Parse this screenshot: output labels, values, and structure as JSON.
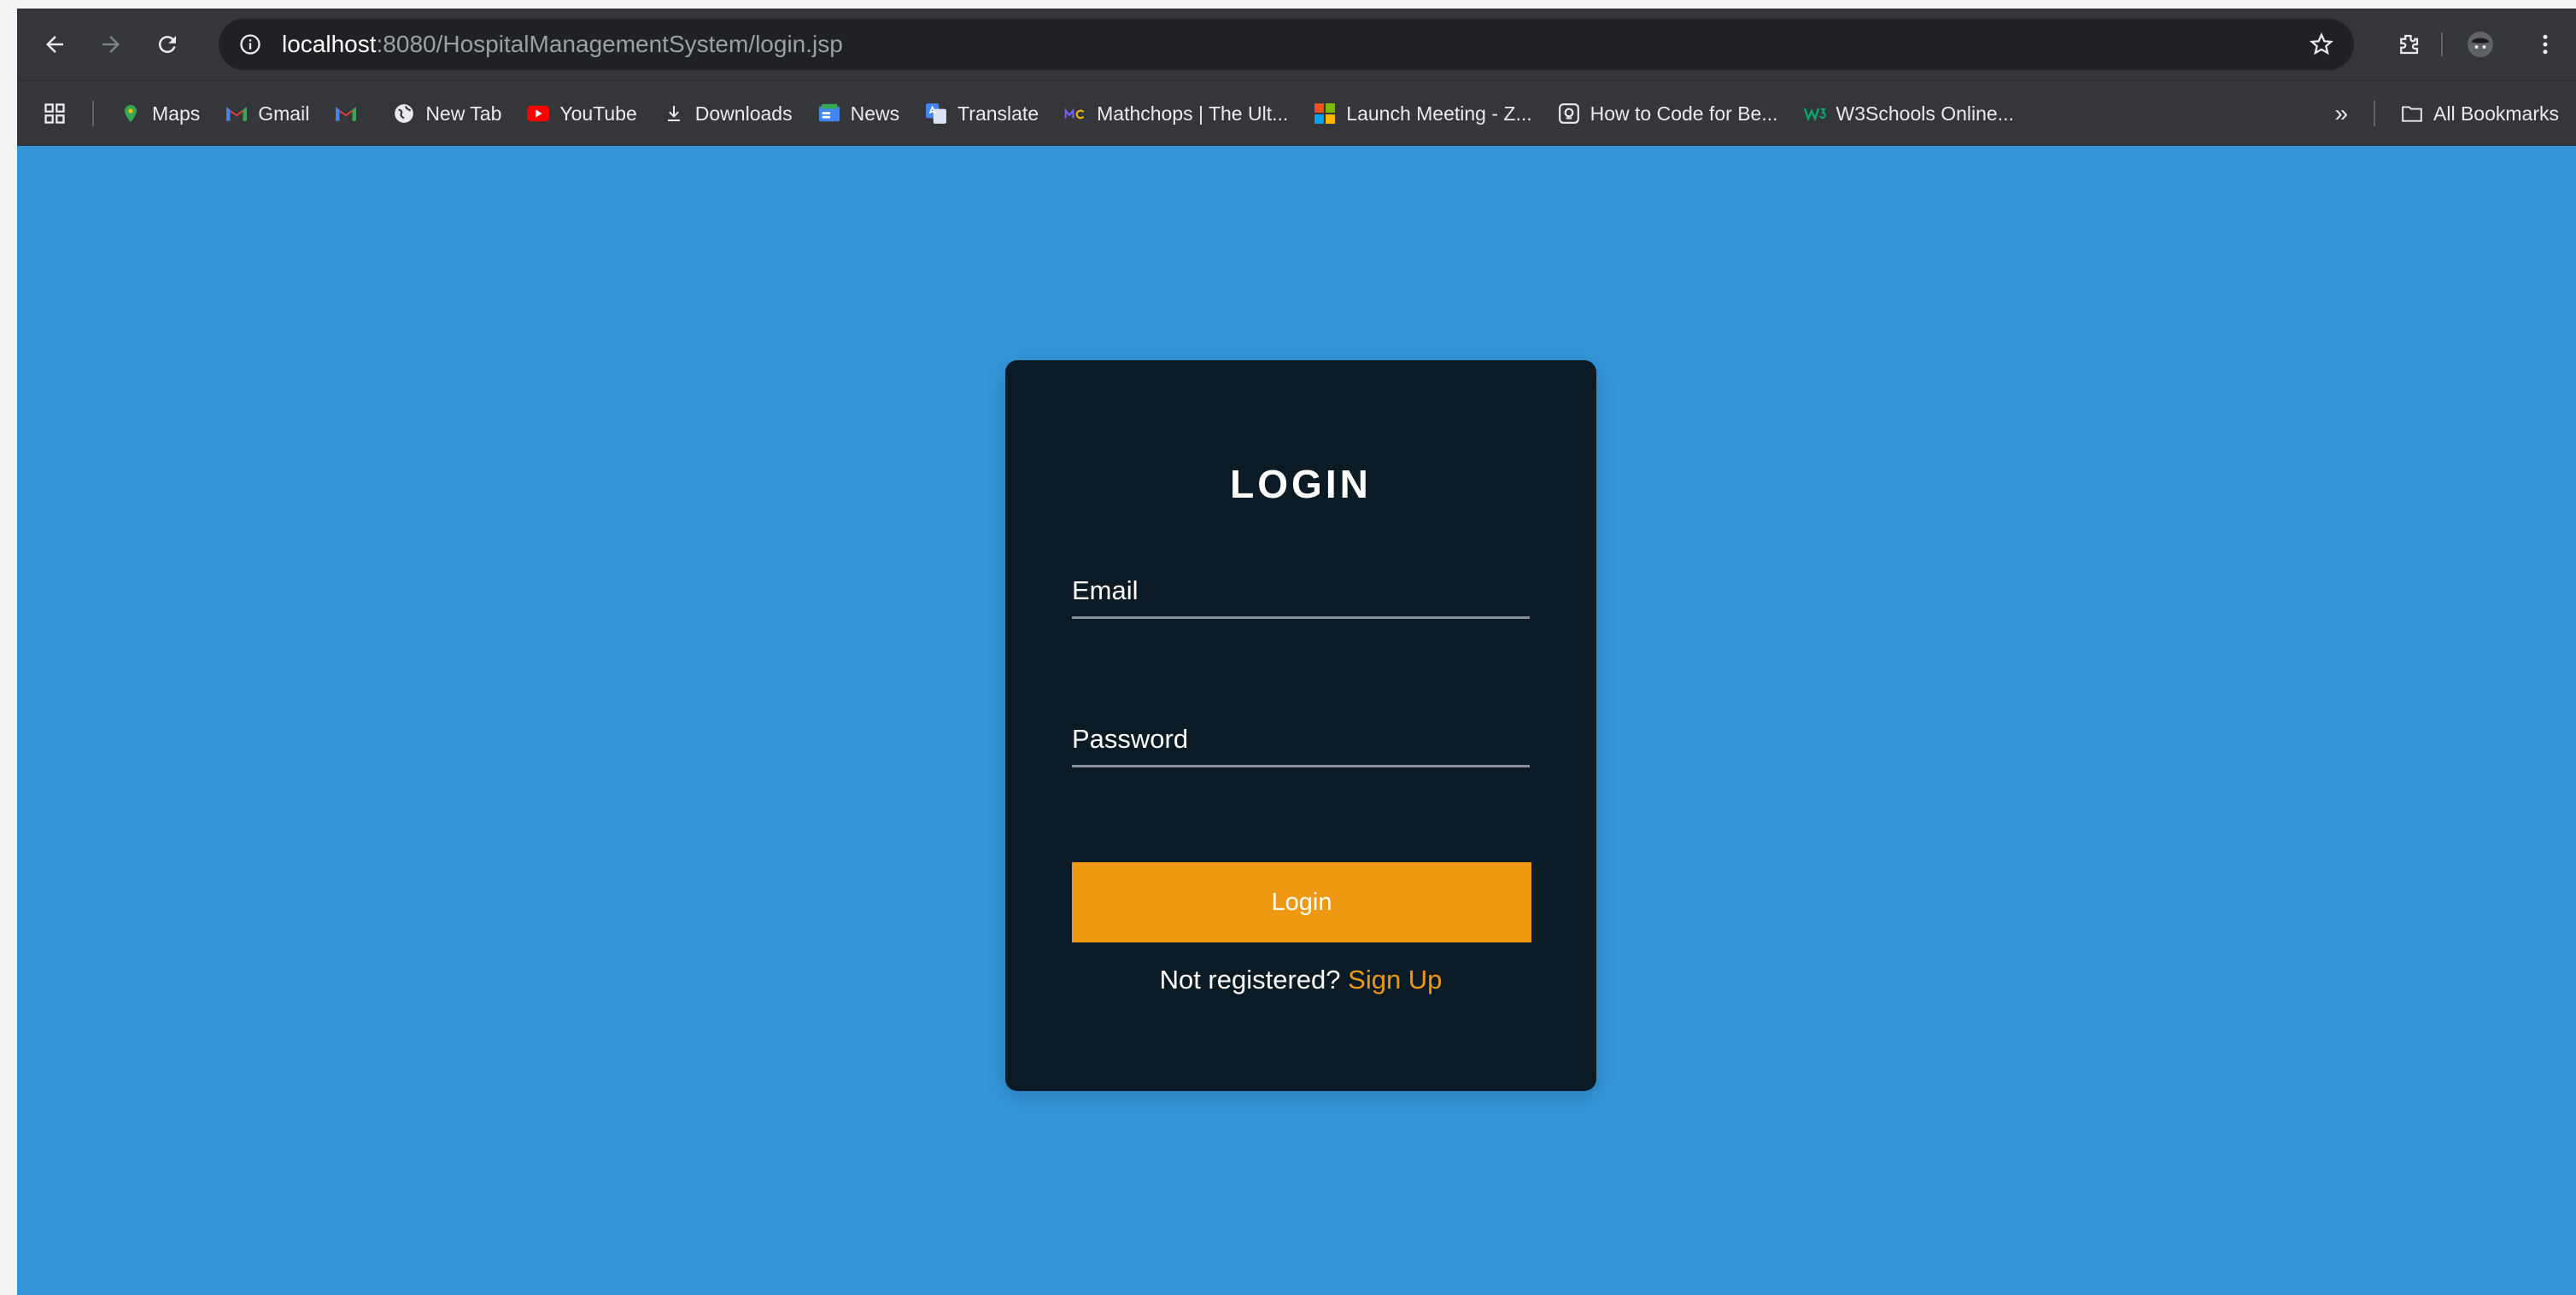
{
  "browser": {
    "url_host": "localhost",
    "url_path": ":8080/HospitalManagementSystem/login.jsp",
    "nav_icons": [
      "back-arrow-icon",
      "forward-arrow-icon",
      "reload-icon",
      "info-icon"
    ],
    "right_icons": [
      "star-icon",
      "extensions-puzzle-icon",
      "profile-avatar-icon",
      "more-vert-icon"
    ]
  },
  "bookmarks": {
    "items": [
      {
        "label": "Maps",
        "icon": "maps-pin-icon",
        "color": "#34a853"
      },
      {
        "label": "Gmail",
        "icon": "gmail-icon",
        "color": "#ea4335"
      },
      {
        "label": "",
        "icon": "gmail-icon",
        "color": "#ea4335"
      },
      {
        "label": "New Tab",
        "icon": "globe-icon",
        "color": "#e8eaed"
      },
      {
        "label": "YouTube",
        "icon": "youtube-icon",
        "color": "#ff0000"
      },
      {
        "label": "Downloads",
        "icon": "download-icon",
        "color": "#e8eaed"
      },
      {
        "label": "News",
        "icon": "google-news-icon",
        "color": "#4285f4"
      },
      {
        "label": "Translate",
        "icon": "translate-icon",
        "color": "#4285f4"
      },
      {
        "label": "Mathchops | The Ult...",
        "icon": "mathchops-icon",
        "color": "#7b61ff"
      },
      {
        "label": "Launch Meeting - Z...",
        "icon": "microsoft-icon",
        "color": "#f25022"
      },
      {
        "label": "How to Code for Be...",
        "icon": "page-icon",
        "color": "#e8eaed"
      },
      {
        "label": "W3Schools Online...",
        "icon": "w3schools-icon",
        "color": "#04aa6d"
      }
    ],
    "more": "»",
    "all_bookmarks": "All Bookmarks"
  },
  "login": {
    "title": "LOGIN",
    "email_placeholder": "Email",
    "password_placeholder": "Password",
    "button_label": "Login",
    "prompt": "Not registered?",
    "signup_link": "Sign Up"
  },
  "colors": {
    "page_background": "#3496d9",
    "card_background": "#0b1b25",
    "accent": "#ef9912"
  }
}
